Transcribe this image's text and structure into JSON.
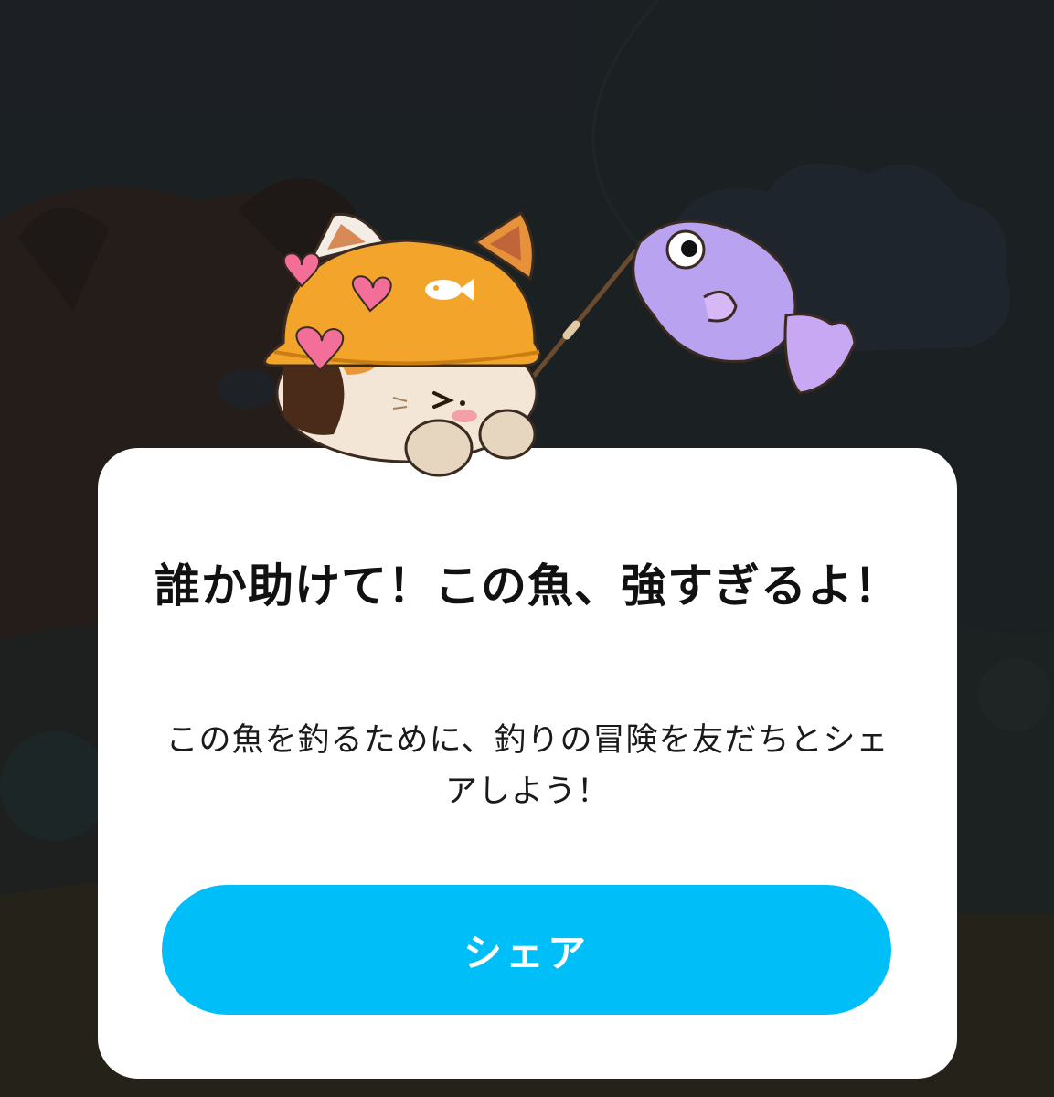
{
  "dialog": {
    "title": "誰か助けて！この魚、強すぎるよ！",
    "body": "この魚を釣るために、釣りの冒険を友だちとシェアしよう！",
    "share_label": "シェア"
  },
  "colors": {
    "background": "#1f2326",
    "dialog_bg": "#ffffff",
    "button_bg": "#00bff8",
    "button_text": "#ffffff",
    "hat": "#f2a52a",
    "fish": "#b9a3f0"
  },
  "icons": {
    "mascot": "cat-fishing-icon",
    "fish": "fish-icon",
    "hearts": "heart-icon"
  }
}
